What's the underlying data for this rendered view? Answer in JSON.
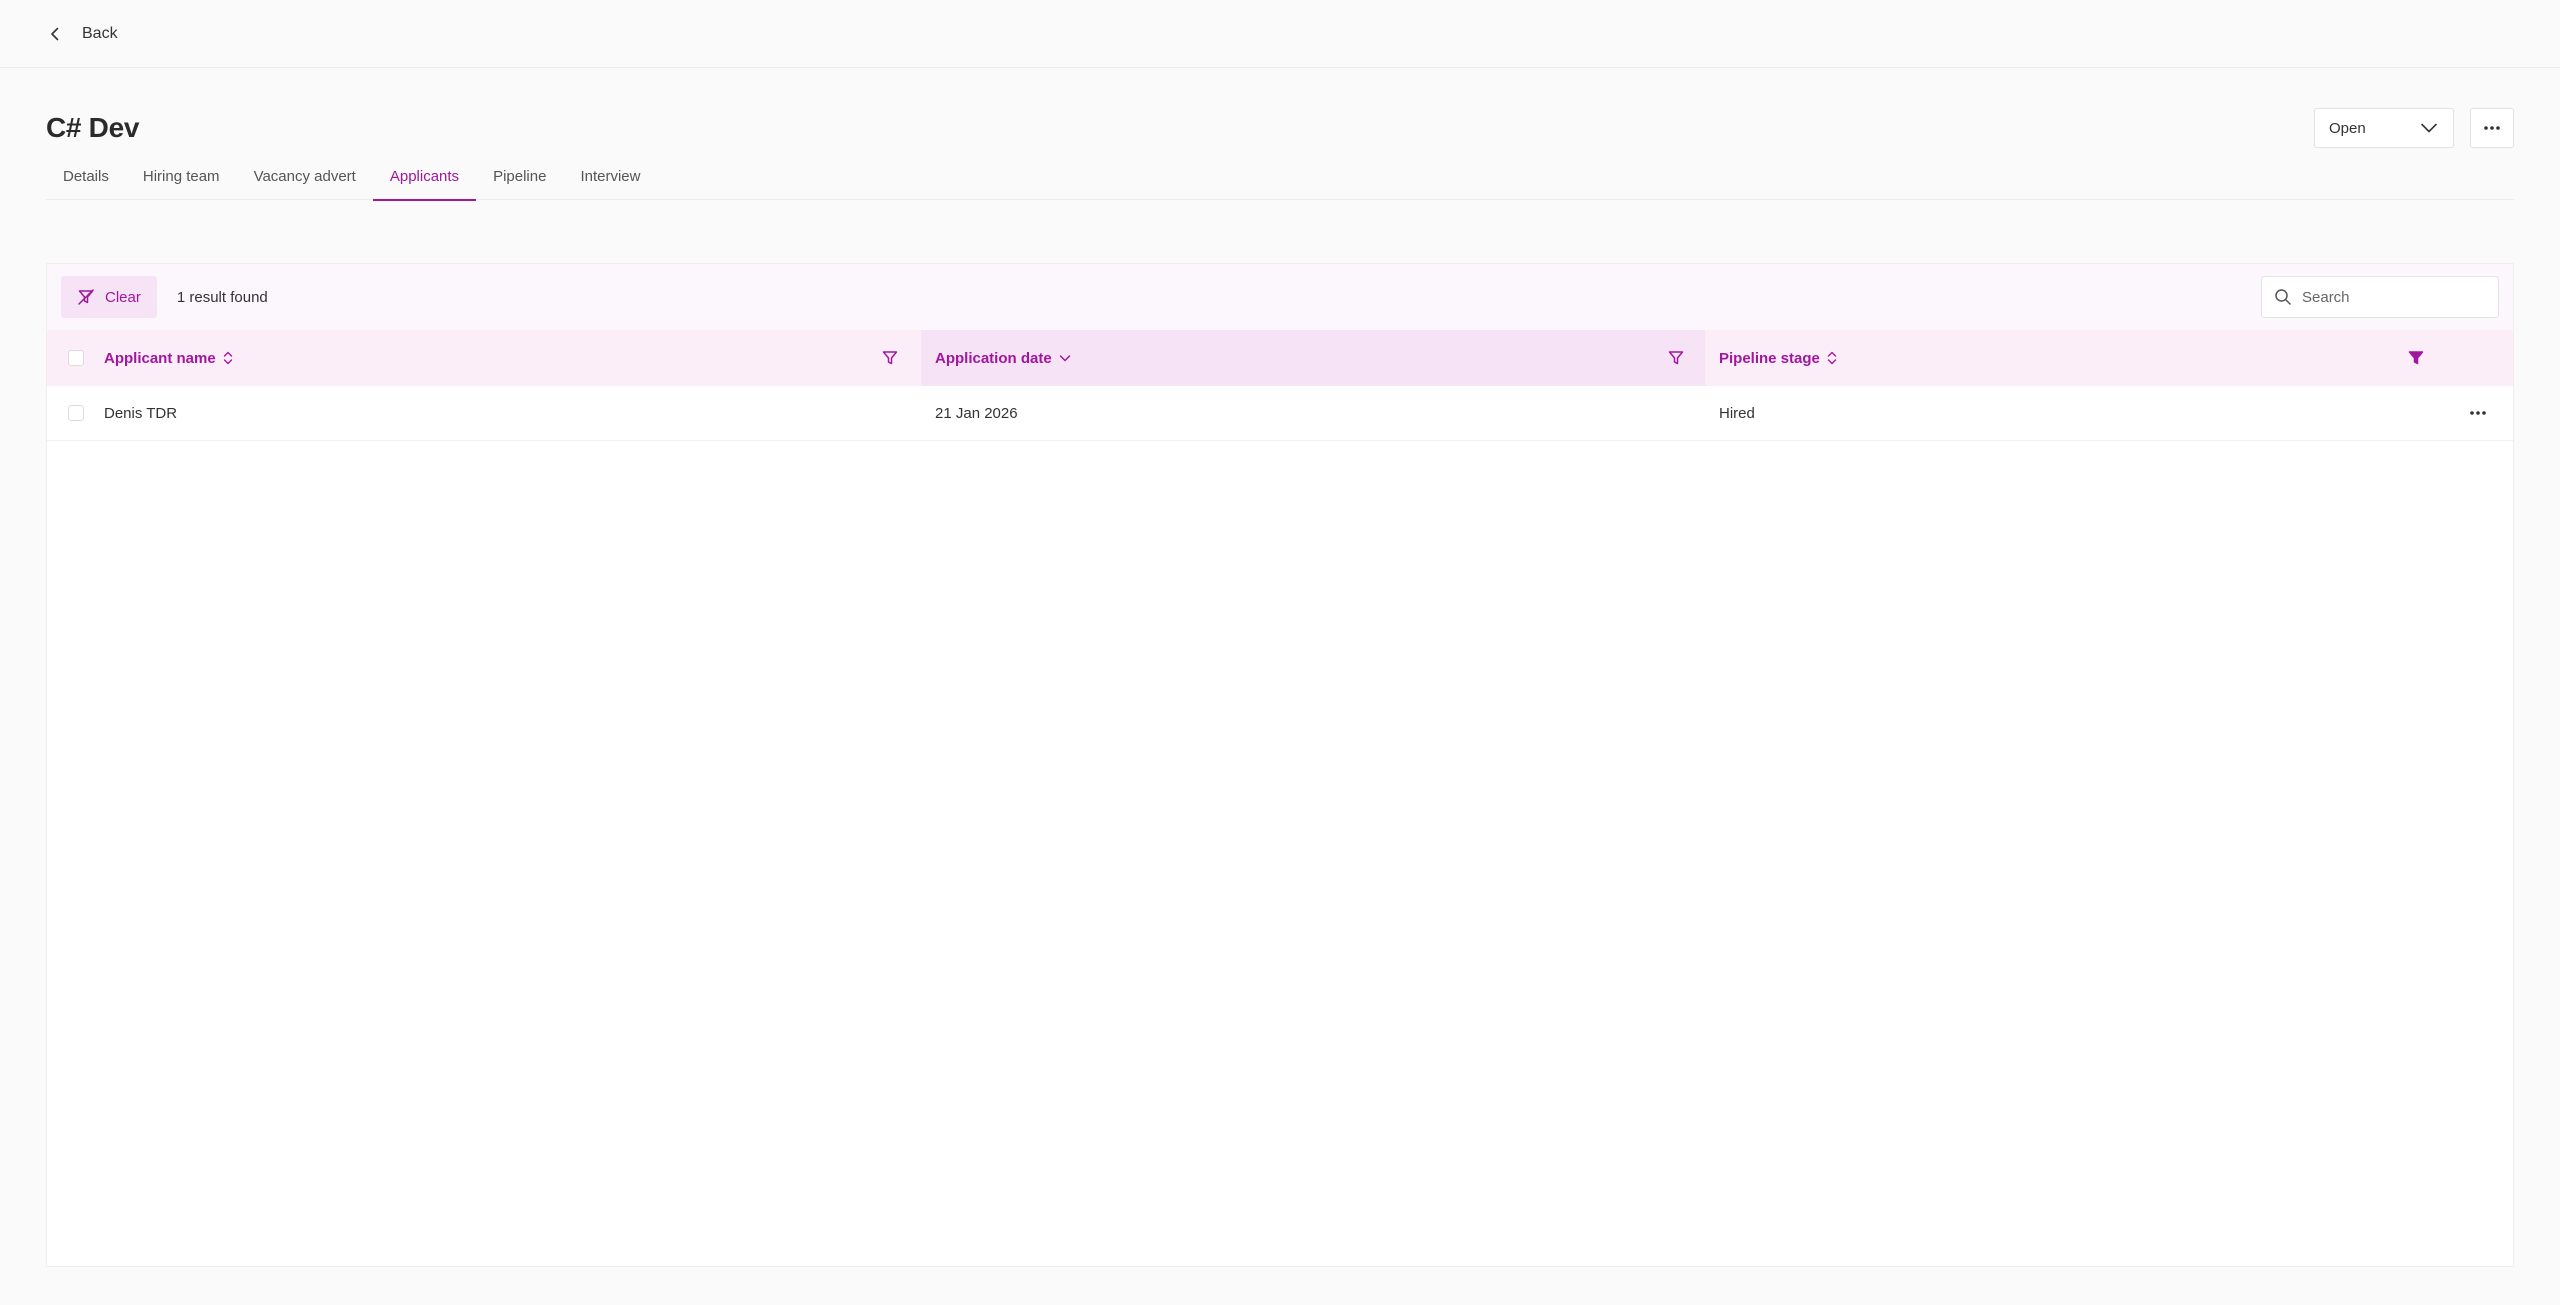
{
  "topbar": {
    "back_label": "Back"
  },
  "header": {
    "title": "C# Dev",
    "status": "Open"
  },
  "tabs": [
    {
      "label": "Details"
    },
    {
      "label": "Hiring team"
    },
    {
      "label": "Vacancy advert"
    },
    {
      "label": "Applicants",
      "active": true
    },
    {
      "label": "Pipeline"
    },
    {
      "label": "Interview"
    }
  ],
  "toolbar": {
    "clear_label": "Clear",
    "result_count": "1 result found",
    "search_placeholder": "Search"
  },
  "table": {
    "columns": [
      {
        "label": "Applicant name"
      },
      {
        "label": "Application date"
      },
      {
        "label": "Pipeline stage"
      }
    ],
    "rows": [
      {
        "name": "Denis TDR",
        "date": "21 Jan 2026",
        "stage": "Hired"
      }
    ]
  },
  "colors": {
    "accent": "#a0179e",
    "header_bg": "#fbeef9",
    "sorted_header_bg": "#f7e3f6"
  }
}
